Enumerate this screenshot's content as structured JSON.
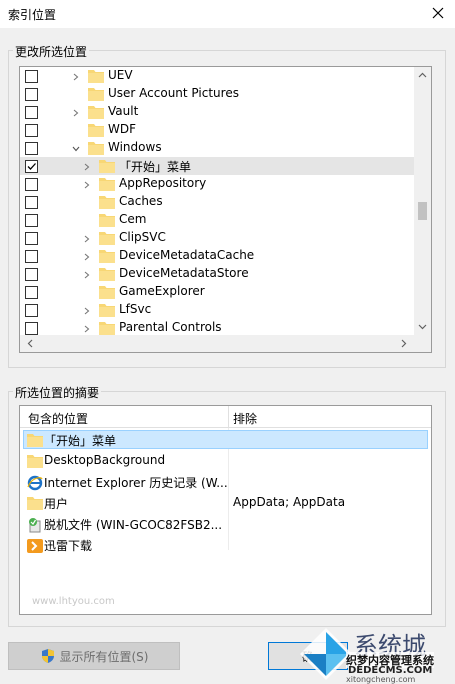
{
  "window": {
    "title": "索引位置"
  },
  "change_group": {
    "label": "更改所选位置"
  },
  "tree": {
    "rows": [
      {
        "label": "UEV",
        "checked": false,
        "expander": "right",
        "indent": 0
      },
      {
        "label": "User Account Pictures",
        "checked": false,
        "expander": "none",
        "indent": 0
      },
      {
        "label": "Vault",
        "checked": false,
        "expander": "right",
        "indent": 0
      },
      {
        "label": "WDF",
        "checked": false,
        "expander": "none",
        "indent": 0
      },
      {
        "label": "Windows",
        "checked": false,
        "expander": "down",
        "indent": 0
      },
      {
        "label": "「开始」菜单",
        "checked": true,
        "expander": "right",
        "indent": 1,
        "selected": true
      },
      {
        "label": "AppRepository",
        "checked": false,
        "expander": "right",
        "indent": 1
      },
      {
        "label": "Caches",
        "checked": false,
        "expander": "none",
        "indent": 1
      },
      {
        "label": "Cem",
        "checked": false,
        "expander": "none",
        "indent": 1
      },
      {
        "label": "ClipSVC",
        "checked": false,
        "expander": "right",
        "indent": 1
      },
      {
        "label": "DeviceMetadataCache",
        "checked": false,
        "expander": "right",
        "indent": 1
      },
      {
        "label": "DeviceMetadataStore",
        "checked": false,
        "expander": "right",
        "indent": 1
      },
      {
        "label": "GameExplorer",
        "checked": false,
        "expander": "none",
        "indent": 1
      },
      {
        "label": "LfSvc",
        "checked": false,
        "expander": "right",
        "indent": 1
      },
      {
        "label": "Parental Controls",
        "checked": false,
        "expander": "right",
        "indent": 1
      }
    ]
  },
  "summary_group": {
    "label": "所选位置的摘要"
  },
  "summary": {
    "headers": {
      "included": "包含的位置",
      "excluded": "排除"
    },
    "rows": [
      {
        "label": "「开始」菜单",
        "icon": "folder-icon",
        "exclude": "",
        "selected": true
      },
      {
        "label": "DesktopBackground",
        "icon": "folder-icon",
        "exclude": ""
      },
      {
        "label": "Internet Explorer 历史记录 (W...",
        "icon": "internet-explorer-icon",
        "exclude": ""
      },
      {
        "label": "用户",
        "icon": "folder-icon",
        "exclude": "AppData; AppData"
      },
      {
        "label": "脱机文件 (WIN-GCOC82FSB2...",
        "icon": "offline-files-icon",
        "exclude": ""
      },
      {
        "label": "迅雷下载",
        "icon": "xunlei-download-icon",
        "exclude": ""
      }
    ],
    "watermark_text": "www.lhtyou.com"
  },
  "buttons": {
    "show_all": "显示所有位置(S)",
    "ok": "确"
  },
  "watermark": {
    "brand": "系统城",
    "line1": "织梦内容管理系统",
    "line2": "DEDECMS.COM",
    "line3": "xitongcheng.com"
  },
  "colors": {
    "selected_row": "#cce8ff",
    "folder": "#f8d775",
    "accent": "#0078d7"
  }
}
